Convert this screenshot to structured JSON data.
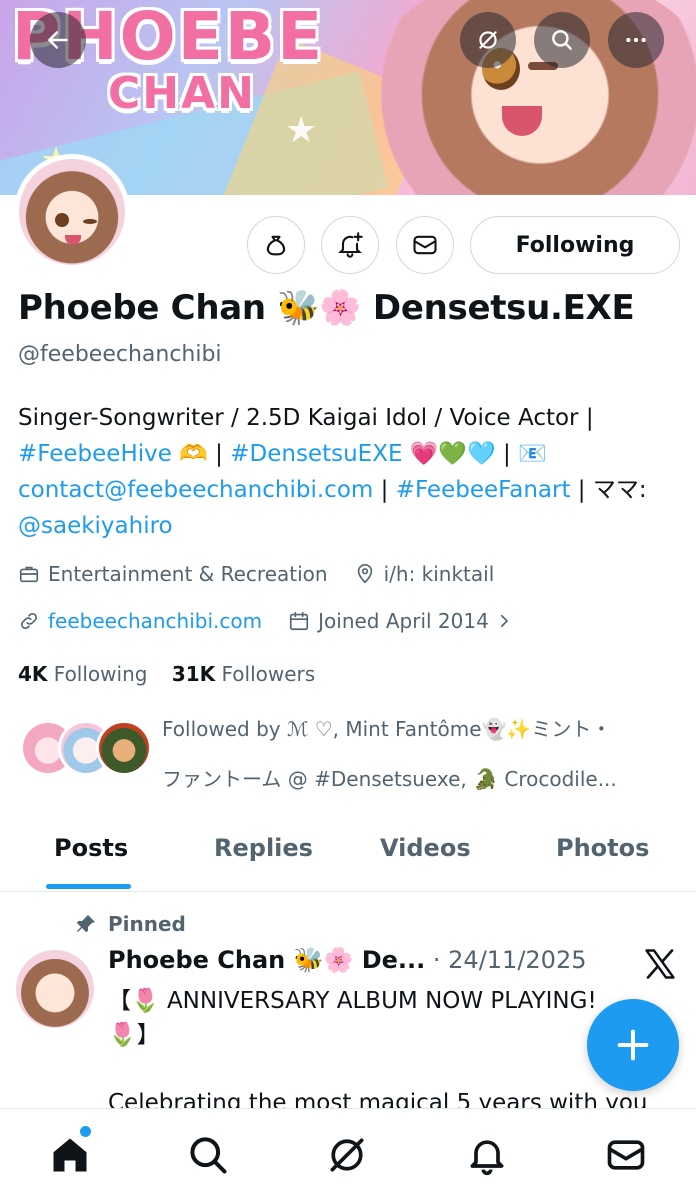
{
  "banner": {
    "logo_line1": "PHOEBE",
    "logo_line2": "CHAN"
  },
  "header_icons": [
    "back-arrow-icon",
    "grok-icon",
    "search-icon",
    "more-icon"
  ],
  "actions": {
    "icons": [
      "gift-icon",
      "bell-plus-icon",
      "message-icon"
    ],
    "following_label": "Following"
  },
  "profile": {
    "name": "Phoebe Chan 🐝🌸 Densetsu.EXE",
    "handle": "@feebeechanchibi",
    "bio": {
      "line1": "Singer-Songwriter / 2.5D Kaigai Idol / Voice Actor |",
      "tag1": "#FeebeeHive",
      "tag1_emoji": " 🫶 | ",
      "tag2": "#DensetsuEXE",
      "tag2_emoji": " 💗💚🩵 | 📧",
      "email": "contact@feebeechanchibi.com",
      "sep": " | ",
      "tag3": "#FeebeeFanart",
      "mama": " | ママ:",
      "artist": "@saekiyahiro"
    },
    "category": "Entertainment & Recreation",
    "location": "i/h: kinktail",
    "website": "feebeechanchibi.com",
    "joined": "Joined April 2014",
    "following_count": "4K",
    "following_label": "Following",
    "followers_count": "31K",
    "followers_label": "Followers",
    "followed_by_line1": "Followed by ℳ ♡, Mint Fantôme👻✨ミント・",
    "followed_by_line2": "ファントーム @ #Densetsuexe, 🐊 Crocodile..."
  },
  "tabs": [
    {
      "label": "Posts",
      "active": true
    },
    {
      "label": "Replies",
      "active": false
    },
    {
      "label": "Videos",
      "active": false
    },
    {
      "label": "Photos",
      "active": false
    }
  ],
  "post": {
    "pinned_label": "Pinned",
    "author": "Phoebe Chan 🐝🌸 De...",
    "date": " · 24/11/2025",
    "text_line1": "【🌷 ANNIVERSARY ALBUM NOW PLAYING!",
    "text_line2": "🌷】",
    "text_line3": "Celebrating the most magical 5 years with you"
  },
  "bottom_nav": [
    "home-icon",
    "search-icon",
    "grok-icon",
    "notifications-icon",
    "messages-icon"
  ],
  "colors": {
    "accent": "#1d9bf0",
    "text": "#0f1419",
    "muted": "#536471",
    "border": "#cfd9de"
  }
}
